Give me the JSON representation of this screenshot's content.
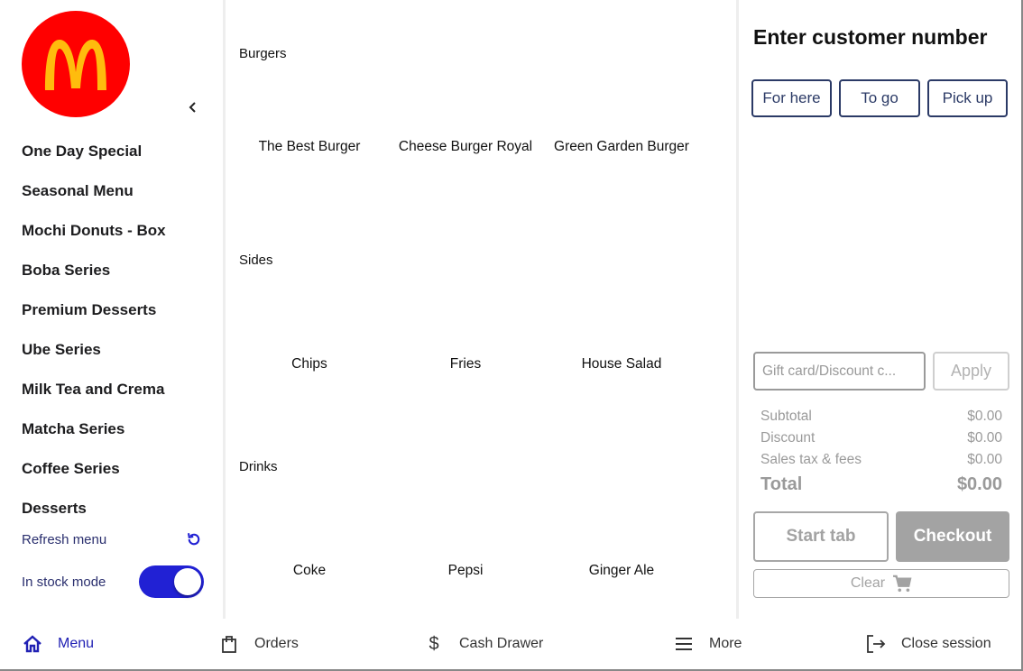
{
  "brand": {
    "logo": "mcdonalds-arches-logo",
    "logo_bg": "#ff0000",
    "logo_fg": "#ffbc0d"
  },
  "sidebar": {
    "collapse_icon": "chevron-left-icon",
    "categories": [
      {
        "label": "One Day Special"
      },
      {
        "label": "Seasonal Menu"
      },
      {
        "label": "Mochi Donuts - Box"
      },
      {
        "label": "Boba Series"
      },
      {
        "label": "Premium Desserts"
      },
      {
        "label": "Ube Series"
      },
      {
        "label": "Milk Tea and Crema"
      },
      {
        "label": "Matcha Series"
      },
      {
        "label": "Coffee Series"
      },
      {
        "label": "Desserts"
      }
    ],
    "refresh_label": "Refresh menu",
    "refresh_icon": "refresh-icon",
    "stock_mode_label": "In stock mode",
    "stock_mode_on": true,
    "accent": "#2121d4"
  },
  "menu": {
    "sections": [
      {
        "title": "Burgers",
        "items": [
          {
            "name": "The Best Burger"
          },
          {
            "name": "Cheese Burger Royal"
          },
          {
            "name": "Green Garden Burger"
          }
        ]
      },
      {
        "title": "Sides",
        "items": [
          {
            "name": "Chips"
          },
          {
            "name": "Fries"
          },
          {
            "name": "House Salad"
          }
        ]
      },
      {
        "title": "Drinks",
        "items": [
          {
            "name": "Coke"
          },
          {
            "name": "Pepsi"
          },
          {
            "name": "Ginger Ale"
          }
        ]
      }
    ]
  },
  "order": {
    "title": "Enter customer number",
    "types": [
      {
        "label": "For here"
      },
      {
        "label": "To go"
      },
      {
        "label": "Pick up"
      }
    ],
    "gift_placeholder": "Gift card/Discount c...",
    "apply_label": "Apply",
    "totals": {
      "subtotal_label": "Subtotal",
      "subtotal": "$0.00",
      "discount_label": "Discount",
      "discount": "$0.00",
      "tax_label": "Sales tax & fees",
      "tax": "$0.00",
      "total_label": "Total",
      "total": "$0.00"
    },
    "start_tab_label": "Start tab",
    "checkout_label": "Checkout",
    "clear_label": "Clear",
    "clear_icon": "cart-icon"
  },
  "bottom_nav": [
    {
      "label": "Menu",
      "icon": "home-icon",
      "active": true
    },
    {
      "label": "Orders",
      "icon": "shopping-bag-icon"
    },
    {
      "label": "Cash Drawer",
      "icon": "dollar-icon"
    },
    {
      "label": "More",
      "icon": "menu-icon"
    },
    {
      "label": "Close session",
      "icon": "logout-icon"
    }
  ]
}
